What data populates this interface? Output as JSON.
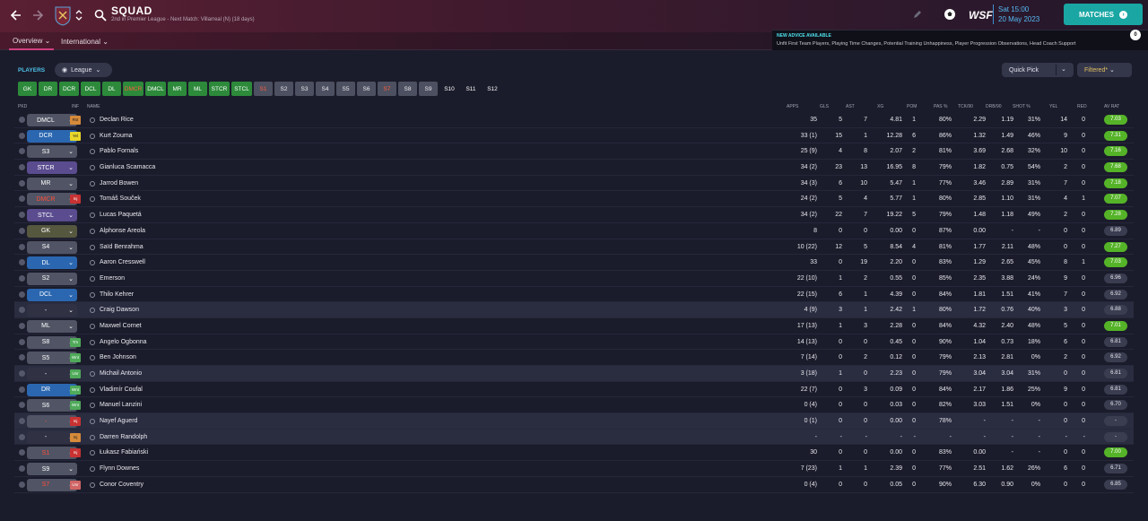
{
  "header": {
    "title": "SQUAD",
    "subtitle": "2nd in Premier League - Next Match: Villarreal (N) (18 days)",
    "date_line1": "Sat 15:00",
    "date_line2": "20 May 2023",
    "brand": "WSF",
    "matches_label": "MATCHES"
  },
  "nav": {
    "overview": "Overview",
    "international": "International"
  },
  "advice": {
    "heading": "NEW ADVICE AVAILABLE",
    "text": "Unfit First Team Players, Playing Time Changes, Potential Training Unhappiness, Player Progression Observations, Head Coach Support",
    "count": "0"
  },
  "players_title": "PLAYERS",
  "league_dropdown": "League",
  "quick_pick": "Quick Pick",
  "filtered": "Filtered*",
  "chips": [
    {
      "label": "GK",
      "style": "green"
    },
    {
      "label": "DR",
      "style": "green"
    },
    {
      "label": "DCR",
      "style": "green"
    },
    {
      "label": "DCL",
      "style": "green"
    },
    {
      "label": "DL",
      "style": "green"
    },
    {
      "label": "DMCR",
      "style": "green red"
    },
    {
      "label": "DMCL",
      "style": "green"
    },
    {
      "label": "MR",
      "style": "green"
    },
    {
      "label": "ML",
      "style": "green"
    },
    {
      "label": "STCR",
      "style": "green"
    },
    {
      "label": "STCL",
      "style": "green"
    },
    {
      "label": "S1",
      "style": "gray red"
    },
    {
      "label": "S2",
      "style": "gray"
    },
    {
      "label": "S3",
      "style": "gray"
    },
    {
      "label": "S4",
      "style": "gray"
    },
    {
      "label": "S5",
      "style": "gray"
    },
    {
      "label": "S6",
      "style": "gray"
    },
    {
      "label": "S7",
      "style": "gray red"
    },
    {
      "label": "S8",
      "style": "gray"
    },
    {
      "label": "S9",
      "style": "gray"
    },
    {
      "label": "S10",
      "style": "dark"
    },
    {
      "label": "S11",
      "style": "dark"
    },
    {
      "label": "S12",
      "style": "dark"
    }
  ],
  "columns": {
    "pkd": "PKD",
    "inf": "INF",
    "name": "NAME",
    "apps": "APPS",
    "gls": "GLS",
    "ast": "AST",
    "xg": "XG",
    "pom": "POM",
    "pas": "PAS %",
    "tck": "TCK/90",
    "drb": "DRB/90",
    "shot": "SHOT %",
    "yel": "YEL",
    "red": "RED",
    "avrat": "AV RAT"
  },
  "players": [
    {
      "pos": "DMCL",
      "pos_style": "gray",
      "inf": "Rst",
      "inf_style": "rst",
      "name": "Declan Rice",
      "apps": "35",
      "gls": "5",
      "ast": "7",
      "xg": "4.81",
      "pom": "1",
      "pas": "80%",
      "tck": "2.29",
      "drb": "1.19",
      "shot": "31%",
      "yel": "14",
      "red": "0",
      "avr": "7.03",
      "avr_style": "g",
      "lite": false
    },
    {
      "pos": "DCR",
      "pos_style": "blue",
      "inf": "Yel",
      "inf_style": "yel",
      "name": "Kurt Zouma",
      "apps": "33 (1)",
      "gls": "15",
      "ast": "1",
      "xg": "12.28",
      "pom": "6",
      "pas": "86%",
      "tck": "1.32",
      "drb": "1.49",
      "shot": "46%",
      "yel": "9",
      "red": "0",
      "avr": "7.31",
      "avr_style": "g",
      "lite": false
    },
    {
      "pos": "S3",
      "pos_style": "gray",
      "inf": "",
      "inf_style": "",
      "name": "Pablo Fornals",
      "apps": "25 (9)",
      "gls": "4",
      "ast": "8",
      "xg": "2.07",
      "pom": "2",
      "pas": "81%",
      "tck": "3.69",
      "drb": "2.68",
      "shot": "32%",
      "yel": "10",
      "red": "0",
      "avr": "7.16",
      "avr_style": "g",
      "lite": false
    },
    {
      "pos": "STCR",
      "pos_style": "purple",
      "inf": "",
      "inf_style": "",
      "name": "Gianluca Scamacca",
      "apps": "34 (2)",
      "gls": "23",
      "ast": "13",
      "xg": "16.95",
      "pom": "8",
      "pas": "79%",
      "tck": "1.82",
      "drb": "0.75",
      "shot": "54%",
      "yel": "2",
      "red": "0",
      "avr": "7.68",
      "avr_style": "g",
      "lite": false
    },
    {
      "pos": "MR",
      "pos_style": "gray",
      "inf": "",
      "inf_style": "",
      "name": "Jarrod Bowen",
      "apps": "34 (3)",
      "gls": "6",
      "ast": "10",
      "xg": "5.47",
      "pom": "1",
      "pas": "77%",
      "tck": "3.46",
      "drb": "2.89",
      "shot": "31%",
      "yel": "7",
      "red": "0",
      "avr": "7.18",
      "avr_style": "g",
      "lite": false
    },
    {
      "pos": "DMCR",
      "pos_style": "redt",
      "inf": "Inj",
      "inf_style": "inj",
      "name": "Tomáš Souček",
      "apps": "24 (2)",
      "gls": "5",
      "ast": "4",
      "xg": "5.77",
      "pom": "1",
      "pas": "80%",
      "tck": "2.85",
      "drb": "1.10",
      "shot": "31%",
      "yel": "4",
      "red": "1",
      "avr": "7.07",
      "avr_style": "g",
      "lite": false
    },
    {
      "pos": "STCL",
      "pos_style": "purple",
      "inf": "",
      "inf_style": "",
      "name": "Lucas Paquetá",
      "apps": "34 (2)",
      "gls": "22",
      "ast": "7",
      "xg": "19.22",
      "pom": "5",
      "pas": "79%",
      "tck": "1.48",
      "drb": "1.18",
      "shot": "49%",
      "yel": "2",
      "red": "0",
      "avr": "7.28",
      "avr_style": "g",
      "lite": false
    },
    {
      "pos": "GK",
      "pos_style": "olive",
      "inf": "",
      "inf_style": "",
      "name": "Alphonse Areola",
      "apps": "8",
      "gls": "0",
      "ast": "0",
      "xg": "0.00",
      "pom": "0",
      "pas": "87%",
      "tck": "0.00",
      "drb": "-",
      "shot": "-",
      "yel": "0",
      "red": "0",
      "avr": "6.89",
      "avr_style": "",
      "lite": false
    },
    {
      "pos": "S4",
      "pos_style": "gray",
      "inf": "",
      "inf_style": "",
      "name": "Saïd Benrahma",
      "apps": "10 (22)",
      "gls": "12",
      "ast": "5",
      "xg": "8.54",
      "pom": "4",
      "pas": "81%",
      "tck": "1.77",
      "drb": "2.11",
      "shot": "48%",
      "yel": "0",
      "red": "0",
      "avr": "7.27",
      "avr_style": "g",
      "lite": false
    },
    {
      "pos": "DL",
      "pos_style": "blue",
      "inf": "",
      "inf_style": "",
      "name": "Aaron Cresswell",
      "apps": "33",
      "gls": "0",
      "ast": "19",
      "xg": "2.20",
      "pom": "0",
      "pas": "83%",
      "tck": "1.29",
      "drb": "2.65",
      "shot": "45%",
      "yel": "8",
      "red": "1",
      "avr": "7.03",
      "avr_style": "g",
      "lite": false
    },
    {
      "pos": "S2",
      "pos_style": "gray",
      "inf": "",
      "inf_style": "",
      "name": "Emerson",
      "apps": "22 (10)",
      "gls": "1",
      "ast": "2",
      "xg": "0.55",
      "pom": "0",
      "pas": "85%",
      "tck": "2.35",
      "drb": "3.88",
      "shot": "24%",
      "yel": "9",
      "red": "0",
      "avr": "6.96",
      "avr_style": "",
      "lite": false
    },
    {
      "pos": "DCL",
      "pos_style": "blue",
      "inf": "",
      "inf_style": "",
      "name": "Thilo Kehrer",
      "apps": "22 (15)",
      "gls": "6",
      "ast": "1",
      "xg": "4.39",
      "pom": "0",
      "pas": "84%",
      "tck": "1.81",
      "drb": "1.51",
      "shot": "41%",
      "yel": "7",
      "red": "0",
      "avr": "6.92",
      "avr_style": "",
      "lite": false
    },
    {
      "pos": "-",
      "pos_style": "none",
      "inf": "",
      "inf_style": "",
      "name": "Craig Dawson",
      "apps": "4 (9)",
      "gls": "3",
      "ast": "1",
      "xg": "2.42",
      "pom": "1",
      "pas": "80%",
      "tck": "1.72",
      "drb": "0.76",
      "shot": "40%",
      "yel": "3",
      "red": "0",
      "avr": "6.88",
      "avr_style": "",
      "lite": true
    },
    {
      "pos": "ML",
      "pos_style": "gray",
      "inf": "",
      "inf_style": "",
      "name": "Maxwel Cornet",
      "apps": "17 (13)",
      "gls": "1",
      "ast": "3",
      "xg": "2.28",
      "pom": "0",
      "pas": "84%",
      "tck": "4.32",
      "drb": "2.40",
      "shot": "48%",
      "yel": "5",
      "red": "0",
      "avr": "7.01",
      "avr_style": "g",
      "lite": false
    },
    {
      "pos": "S8",
      "pos_style": "gray",
      "inf": "Trn",
      "inf_style": "wnt",
      "name": "Angelo Ogbonna",
      "apps": "14 (13)",
      "gls": "0",
      "ast": "0",
      "xg": "0.45",
      "pom": "0",
      "pas": "90%",
      "tck": "1.04",
      "drb": "0.73",
      "shot": "18%",
      "yel": "6",
      "red": "0",
      "avr": "6.81",
      "avr_style": "",
      "lite": false
    },
    {
      "pos": "S5",
      "pos_style": "gray",
      "inf": "Wnt",
      "inf_style": "wnt",
      "name": "Ben Johnson",
      "apps": "7 (14)",
      "gls": "0",
      "ast": "2",
      "xg": "0.12",
      "pom": "0",
      "pas": "79%",
      "tck": "2.13",
      "drb": "2.81",
      "shot": "0%",
      "yel": "2",
      "red": "0",
      "avr": "6.92",
      "avr_style": "",
      "lite": false
    },
    {
      "pos": "-",
      "pos_style": "none",
      "inf": "Unr",
      "inf_style": "wnt",
      "name": "Michail Antonio",
      "apps": "3 (18)",
      "gls": "1",
      "ast": "0",
      "xg": "2.23",
      "pom": "0",
      "pas": "79%",
      "tck": "3.04",
      "drb": "3.04",
      "shot": "31%",
      "yel": "0",
      "red": "0",
      "avr": "6.81",
      "avr_style": "",
      "lite": true
    },
    {
      "pos": "DR",
      "pos_style": "blue",
      "inf": "Wnt",
      "inf_style": "wnt",
      "name": "Vladimír Coufal",
      "apps": "22 (7)",
      "gls": "0",
      "ast": "3",
      "xg": "0.09",
      "pom": "0",
      "pas": "84%",
      "tck": "2.17",
      "drb": "1.86",
      "shot": "25%",
      "yel": "9",
      "red": "0",
      "avr": "6.81",
      "avr_style": "",
      "lite": false
    },
    {
      "pos": "S6",
      "pos_style": "gray",
      "inf": "Wnt",
      "inf_style": "wnt",
      "name": "Manuel Lanzini",
      "apps": "0 (4)",
      "gls": "0",
      "ast": "0",
      "xg": "0.03",
      "pom": "0",
      "pas": "82%",
      "tck": "3.03",
      "drb": "1.51",
      "shot": "0%",
      "yel": "0",
      "red": "0",
      "avr": "6.70",
      "avr_style": "",
      "lite": false
    },
    {
      "pos": "-",
      "pos_style": "redt",
      "inf": "Inj",
      "inf_style": "inj",
      "name": "Nayef Aguerd",
      "apps": "0 (1)",
      "gls": "0",
      "ast": "0",
      "xg": "0.00",
      "pom": "0",
      "pas": "78%",
      "tck": "-",
      "drb": "-",
      "shot": "-",
      "yel": "0",
      "red": "0",
      "avr": "-",
      "avr_style": "",
      "lite": true
    },
    {
      "pos": "-",
      "pos_style": "none",
      "inf": "Inj",
      "inf_style": "rst",
      "name": "Darren Randolph",
      "apps": "-",
      "gls": "-",
      "ast": "-",
      "xg": "-",
      "pom": "-",
      "pas": "-",
      "tck": "-",
      "drb": "-",
      "shot": "-",
      "yel": "-",
      "red": "-",
      "avr": "-",
      "avr_style": "",
      "lite": true
    },
    {
      "pos": "S1",
      "pos_style": "redt",
      "inf": "Inj",
      "inf_style": "inj",
      "name": "Łukasz Fabiański",
      "apps": "30",
      "gls": "0",
      "ast": "0",
      "xg": "0.00",
      "pom": "0",
      "pas": "83%",
      "tck": "0.00",
      "drb": "-",
      "shot": "-",
      "yel": "0",
      "red": "0",
      "avr": "7.00",
      "avr_style": "g",
      "lite": false
    },
    {
      "pos": "S9",
      "pos_style": "gray",
      "inf": "",
      "inf_style": "",
      "name": "Flynn Downes",
      "apps": "7 (23)",
      "gls": "1",
      "ast": "1",
      "xg": "2.39",
      "pom": "0",
      "pas": "77%",
      "tck": "2.51",
      "drb": "1.62",
      "shot": "26%",
      "yel": "6",
      "red": "0",
      "avr": "6.71",
      "avr_style": "",
      "lite": false
    },
    {
      "pos": "S7",
      "pos_style": "redt",
      "inf": "Unr",
      "inf_style": "unr",
      "name": "Conor Coventry",
      "apps": "0 (4)",
      "gls": "0",
      "ast": "0",
      "xg": "0.05",
      "pom": "0",
      "pas": "90%",
      "tck": "6.30",
      "drb": "0.90",
      "shot": "0%",
      "yel": "0",
      "red": "0",
      "avr": "6.85",
      "avr_style": "",
      "lite": false
    }
  ]
}
